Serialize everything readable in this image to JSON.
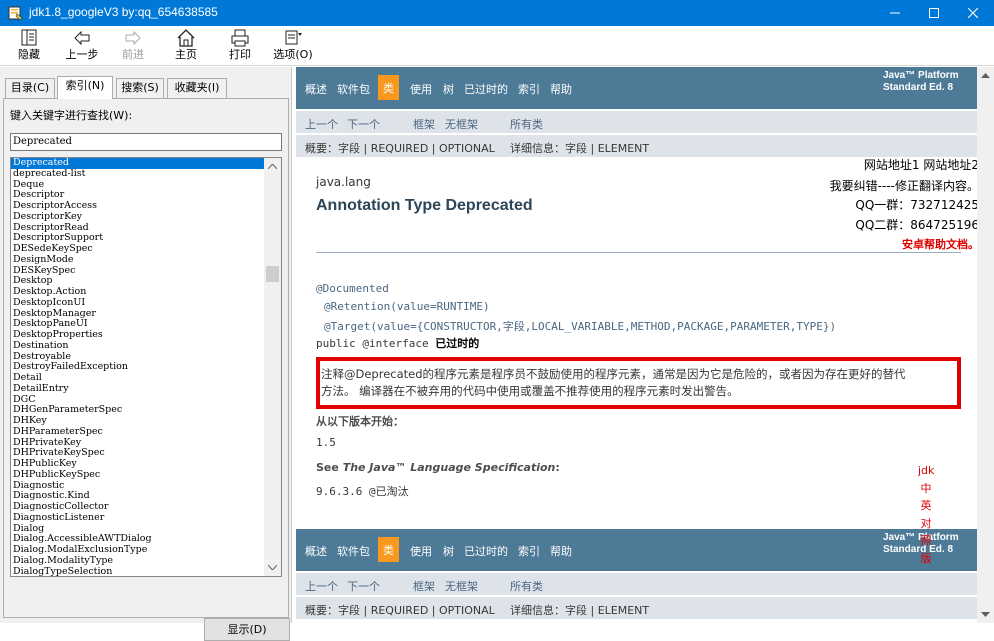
{
  "window": {
    "title": "jdk1.8_googleV3 by:qq_654638585",
    "icon": "chm-help-icon"
  },
  "toolbar": {
    "hide": "隐藏",
    "back": "上一步",
    "forward": "前进",
    "home": "主页",
    "print": "打印",
    "options": "选项(O)"
  },
  "left": {
    "tabs": [
      "目录(C)",
      "索引(N)",
      "搜索(S)",
      "收藏夹(I)"
    ],
    "active_tab": "索引(N)",
    "keyword_label": "键入关键字进行查找(W):",
    "keyword_value": "Deprecated",
    "items": [
      "Deprecated",
      "deprecated-list",
      "Deque",
      "Descriptor",
      "DescriptorAccess",
      "DescriptorKey",
      "DescriptorRead",
      "DescriptorSupport",
      "DESedeKeySpec",
      "DesignMode",
      "DESKeySpec",
      "Desktop",
      "Desktop.Action",
      "DesktopIconUI",
      "DesktopManager",
      "DesktopPaneUI",
      "DesktopProperties",
      "Destination",
      "Destroyable",
      "DestroyFailedException",
      "Detail",
      "DetailEntry",
      "DGC",
      "DHGenParameterSpec",
      "DHKey",
      "DHParameterSpec",
      "DHPrivateKey",
      "DHPrivateKeySpec",
      "DHPublicKey",
      "DHPublicKeySpec",
      "Diagnostic",
      "Diagnostic.Kind",
      "DiagnosticCollector",
      "DiagnosticListener",
      "Dialog",
      "Dialog.AccessibleAWTDialog",
      "Dialog.ModalExclusionType",
      "Dialog.ModalityType",
      "DialogTypeSelection"
    ],
    "selected_index": 0,
    "show_button": "显示(D)"
  },
  "doc": {
    "nav": [
      "概述",
      "软件包",
      "类",
      "使用",
      "树",
      "已过时的",
      "索引",
      "帮助"
    ],
    "nav_current": "类",
    "platform_line1": "Java™ Platform",
    "platform_line2": "Standard Ed. 8",
    "prev": "上一个",
    "next": "下一个",
    "frames": "框架",
    "noframes": "无框架",
    "allclasses": "所有类",
    "summary": "概要：字段 | REQUIRED | OPTIONAL",
    "detail": "详细信息：字段 | ELEMENT",
    "package": "java.lang",
    "title": "Annotation Type Deprecated",
    "site_links": "网站地址1 网站地址2",
    "correction": "我要纠错----修正翻译内容。",
    "qq1": "QQ一群：732712425",
    "qq2": "QQ二群：864725196",
    "android_docs": "安卓帮助文档。",
    "anno1": "@Documented",
    "anno2": "@Retention(value=RUNTIME)",
    "anno3": "@Target(value={CONSTRUCTOR,字段,LOCAL_VARIABLE,METHOD,PACKAGE,PARAMETER,TYPE})",
    "decl_prefix": "public @interface ",
    "decl_name": "已过时的",
    "description_line1": "注释@Deprecated的程序元素是程序员不鼓励使用的程序元素，通常是因为它是危险的，或者因为存在更好的替代",
    "description_line2": "方法。 编译器在不被弃用的代码中使用或覆盖不推荐使用的程序元素时发出警告。",
    "since_label": "从以下版本开始：",
    "since_value": "1.5",
    "see_prefix": "See ",
    "see_title": "The Java™ Language Specification",
    "see_suffix": ":",
    "see_value": "9.6.3.6 @已淘汰",
    "vertical_label": [
      "jdk",
      "中",
      "英",
      "对",
      "照",
      "版"
    ]
  },
  "colors": {
    "titlebar": "#0078d7",
    "navbar": "#4d7a97",
    "nav_current": "#f8981d",
    "subnav": "#dee3e9",
    "highlight_border": "#e00000"
  }
}
